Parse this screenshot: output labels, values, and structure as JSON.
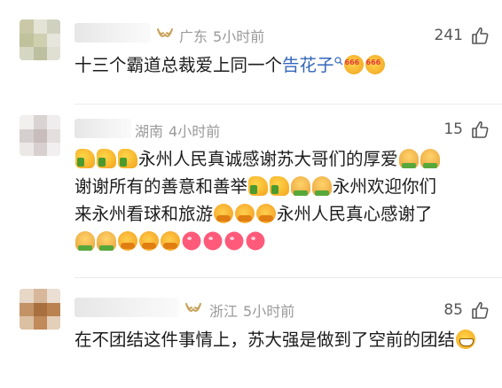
{
  "comments": [
    {
      "vip_icon": "vip-crown-icon",
      "location": "广东",
      "time": "5小时前",
      "likes": "241",
      "text_before_link": "十三个霸道总裁爱上同一个",
      "link": "告花子",
      "emojis": [
        "emoji-666",
        "emoji-666"
      ]
    },
    {
      "location": "湖南",
      "time": "4小时前",
      "likes": "15",
      "text": [
        "永州人民真诚感谢苏大哥们的厚爱",
        "谢谢所有的善意和善举",
        "永州欢迎你们",
        "来永州看球和旅游",
        "永州人民真心感谢了"
      ]
    },
    {
      "vip_icon": "vip-crown-icon",
      "location": "浙江",
      "time": "5小时前",
      "likes": "85",
      "text": "在不团结这件事情上，苏大强是做到了空前的团结"
    }
  ],
  "colors": {
    "link": "#3366bb",
    "meta": "#9a9a9a",
    "divider": "#ececec"
  }
}
